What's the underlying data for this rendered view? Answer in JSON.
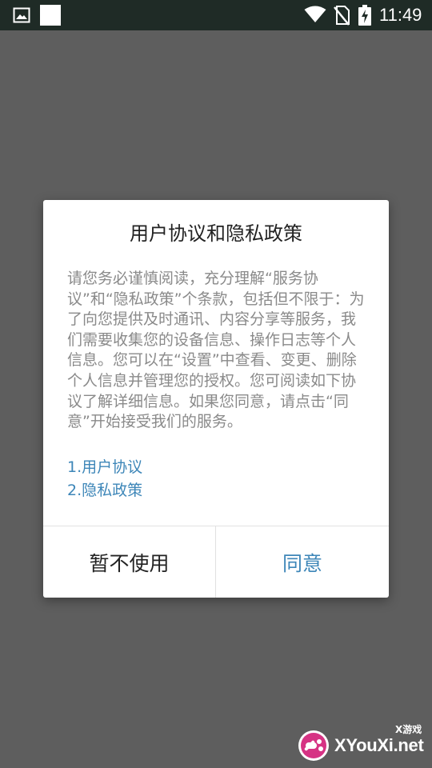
{
  "status_bar": {
    "time": "11:49",
    "icons": [
      "gallery-icon",
      "notification-square-icon",
      "wifi-icon",
      "no-sim-icon",
      "battery-charging-icon"
    ]
  },
  "dialog": {
    "title": "用户协议和隐私政策",
    "body": "请您务必谨慎阅读，充分理解“服务协议”和“隐私政策”个条款，包括但不限于：为了向您提供及时通讯、内容分享等服务，我们需要收集您的设备信息、操作日志等个人信息。您可以在“设置”中查看、变更、删除个人信息并管理您的授权。您可阅读如下协议了解详细信息。如果您同意，请点击“同意”开始接受我们的服务。",
    "links": [
      {
        "label": "1.用户协议"
      },
      {
        "label": "2.隐私政策"
      }
    ],
    "decline_label": "暂不使用",
    "agree_label": "同意"
  },
  "watermark": {
    "small_text": "X游戏",
    "main_text": "XYouXi.net"
  },
  "colors": {
    "overlay": "#5e5e5e",
    "status_bar": "#1f2b26",
    "accent": "#3d86b8",
    "body_text": "#8a8a8a",
    "title_text": "#222222"
  }
}
